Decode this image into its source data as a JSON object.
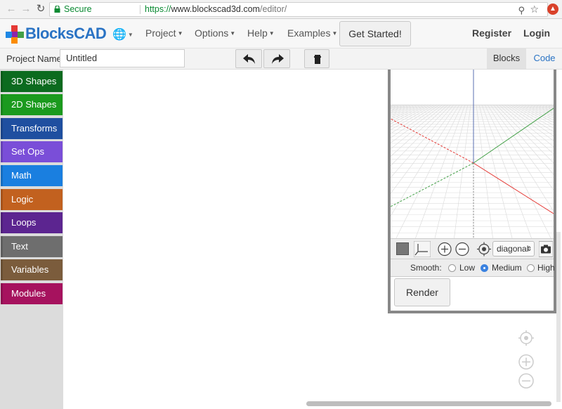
{
  "browser": {
    "secure_label": "Secure",
    "url_scheme": "https://",
    "url_host": "www.blockscad3d.com",
    "url_path": "/editor/"
  },
  "navbar": {
    "logo_text": "BlocksCAD",
    "menus": [
      {
        "label": "Project"
      },
      {
        "label": "Options"
      },
      {
        "label": "Help"
      },
      {
        "label": "Examples"
      }
    ],
    "get_started_label": "Get Started!",
    "register_label": "Register",
    "login_label": "Login"
  },
  "project_bar": {
    "label": "Project Name",
    "name_value": "Untitled",
    "tabs": [
      {
        "label": "Blocks"
      },
      {
        "label": "Code"
      }
    ]
  },
  "categories": [
    {
      "label": "3D Shapes",
      "color": "#0c6b1f"
    },
    {
      "label": "2D Shapes",
      "color": "#1b9a1e"
    },
    {
      "label": "Transforms",
      "color": "#1f4fa0"
    },
    {
      "label": "Set Ops",
      "color": "#7a4ed8"
    },
    {
      "label": "Math",
      "color": "#1a7fe0"
    },
    {
      "label": "Logic",
      "color": "#c2611f"
    },
    {
      "label": "Loops",
      "color": "#5c2590"
    },
    {
      "label": "Text",
      "color": "#6e6e6e"
    },
    {
      "label": "Variables",
      "color": "#7b5c3c"
    },
    {
      "label": "Modules",
      "color": "#a6125e"
    }
  ],
  "viewer": {
    "view_select_value": "diagonal",
    "smooth_label": "Smooth:",
    "smooth_options": [
      {
        "label": "Low",
        "selected": false
      },
      {
        "label": "Medium",
        "selected": true
      },
      {
        "label": "High",
        "selected": false
      }
    ],
    "render_label": "Render"
  }
}
